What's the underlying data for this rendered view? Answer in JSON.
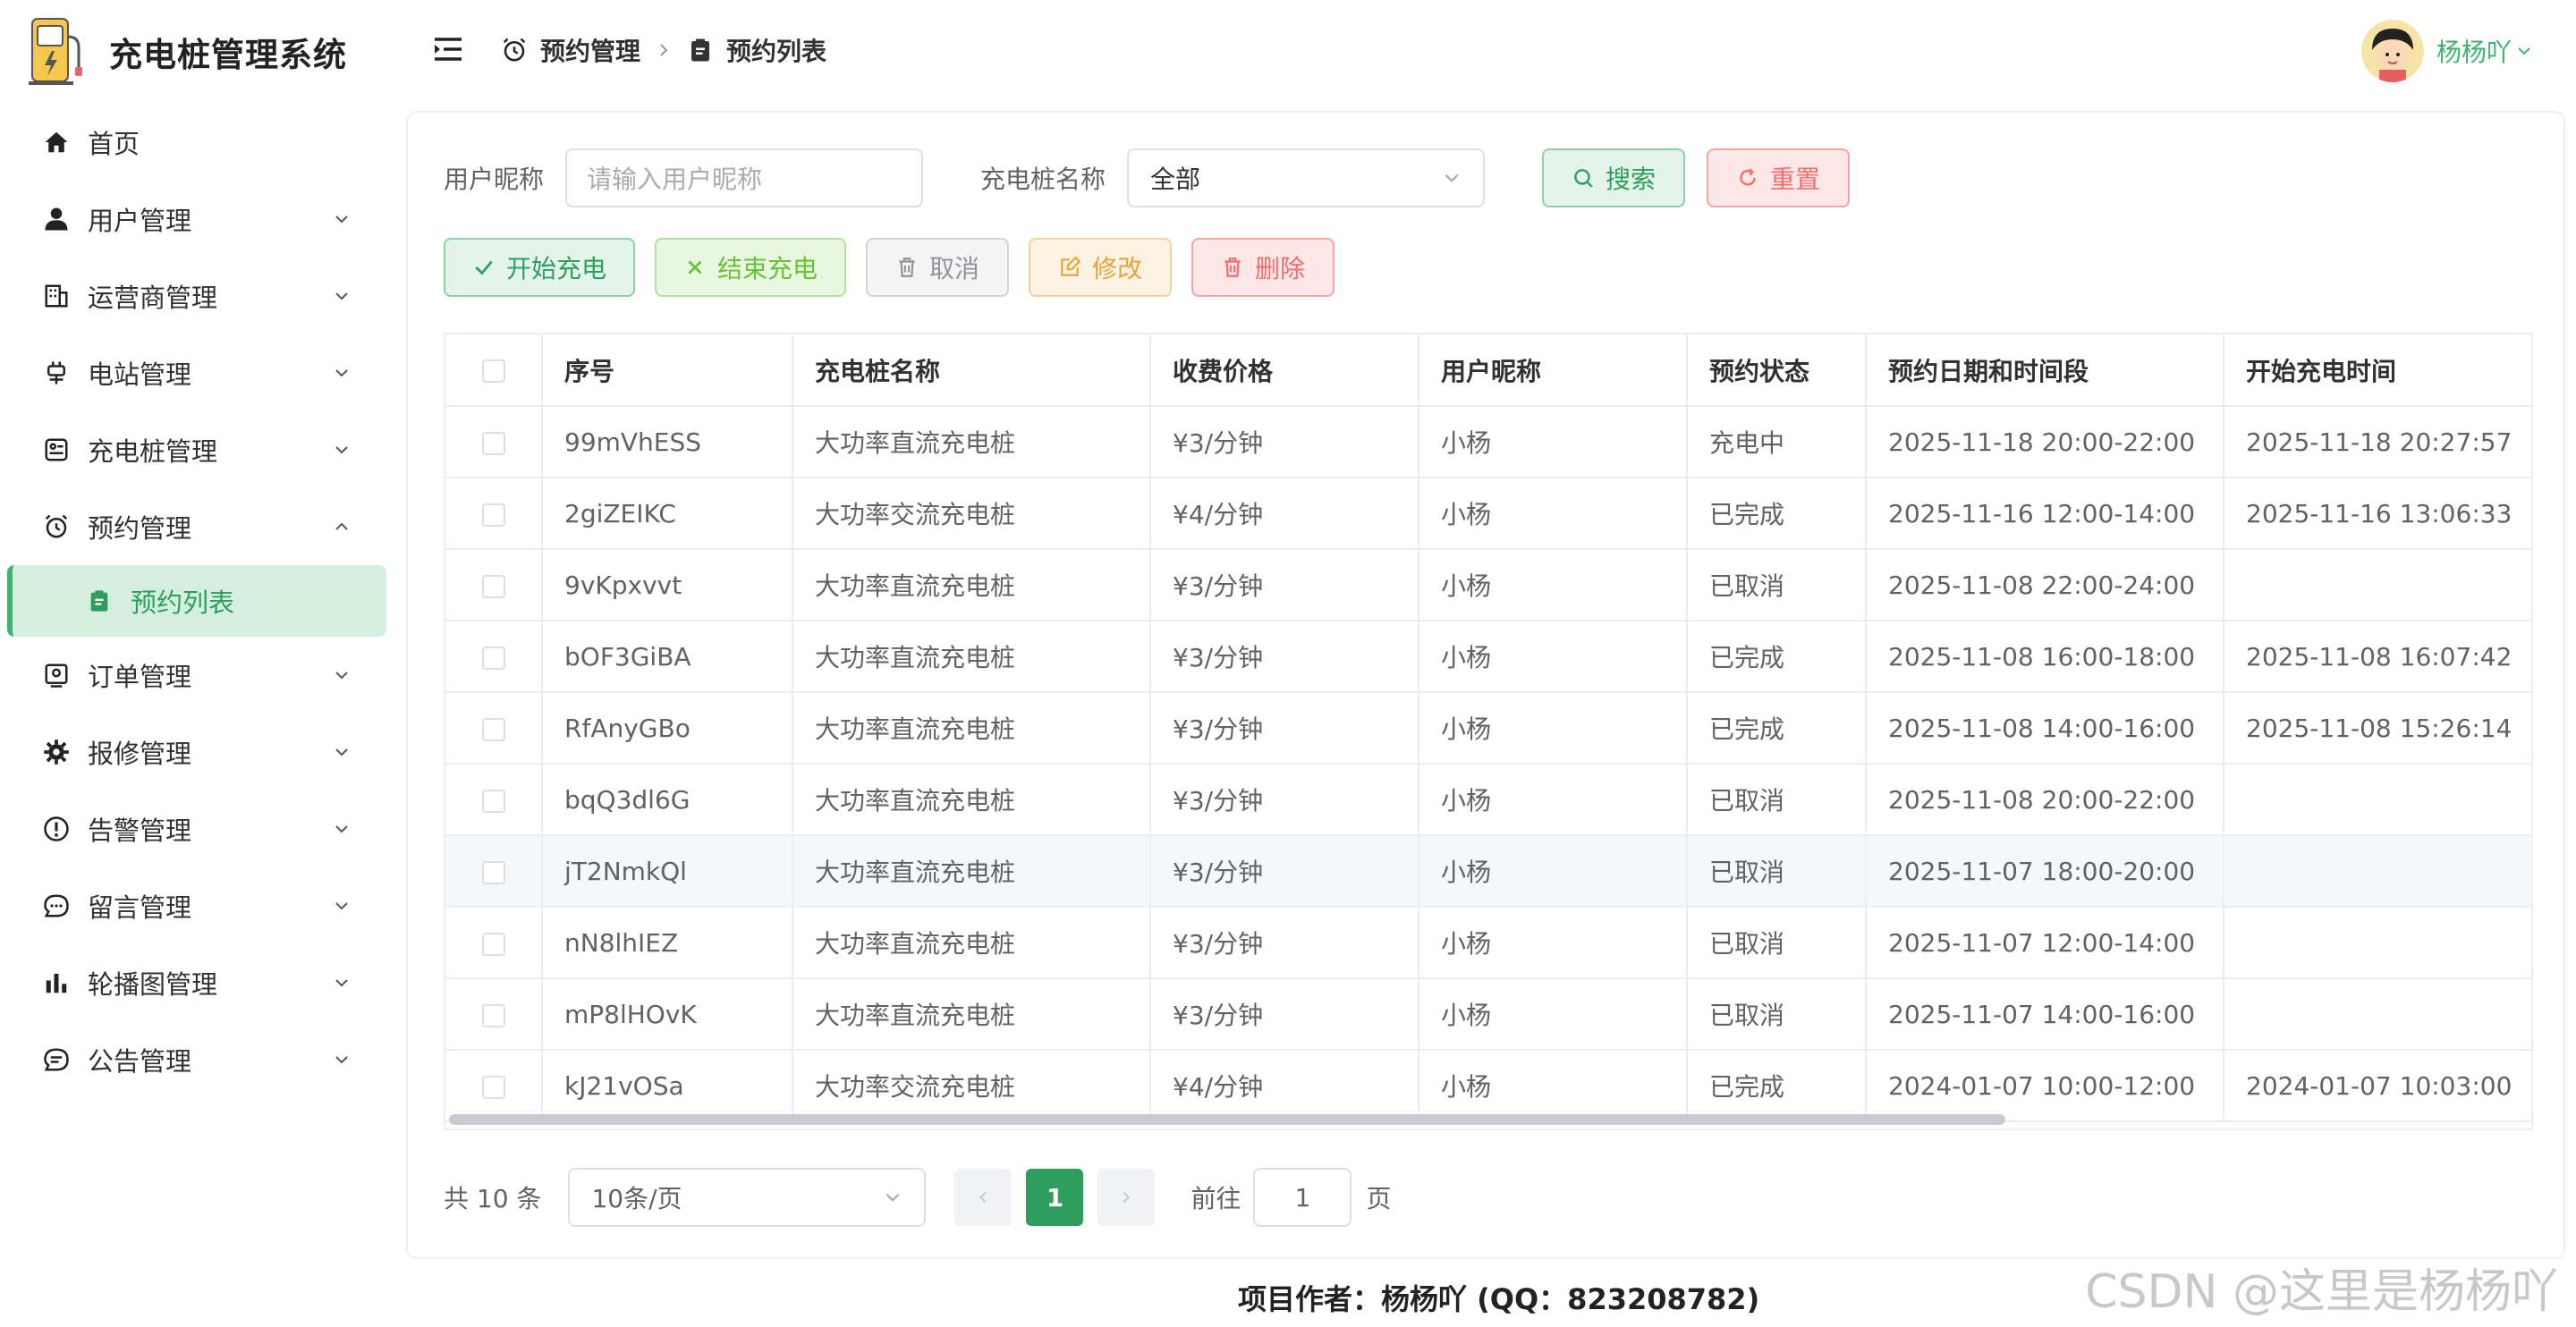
{
  "app": {
    "title": "充电桩管理系统"
  },
  "sidebar": {
    "items": [
      {
        "label": "首页",
        "icon": "home-icon",
        "has_chevron": false
      },
      {
        "label": "用户管理",
        "icon": "user-icon",
        "has_chevron": true
      },
      {
        "label": "运营商管理",
        "icon": "building-icon",
        "has_chevron": true
      },
      {
        "label": "电站管理",
        "icon": "plug-icon",
        "has_chevron": true
      },
      {
        "label": "充电桩管理",
        "icon": "charger-icon",
        "has_chevron": true
      },
      {
        "label": "预约管理",
        "icon": "alarm-clock-icon",
        "has_chevron": true,
        "expanded": true
      },
      {
        "label": "预约列表",
        "icon": "clipboard-icon",
        "sub": true,
        "active": true
      },
      {
        "label": "订单管理",
        "icon": "order-icon",
        "has_chevron": true
      },
      {
        "label": "报修管理",
        "icon": "gear-icon",
        "has_chevron": true
      },
      {
        "label": "告警管理",
        "icon": "warning-icon",
        "has_chevron": true
      },
      {
        "label": "留言管理",
        "icon": "chat-icon",
        "has_chevron": true
      },
      {
        "label": "轮播图管理",
        "icon": "bar-chart-icon",
        "has_chevron": true
      },
      {
        "label": "公告管理",
        "icon": "notice-icon",
        "has_chevron": true
      }
    ]
  },
  "header": {
    "breadcrumb": [
      "预约管理",
      "预约列表"
    ],
    "user_name": "杨杨吖"
  },
  "filters": {
    "nickname_label": "用户昵称",
    "nickname_placeholder": "请输入用户昵称",
    "charger_label": "充电桩名称",
    "charger_value": "全部",
    "search_label": "搜索",
    "reset_label": "重置"
  },
  "actions": {
    "start": "开始充电",
    "end": "结束充电",
    "cancel": "取消",
    "edit": "修改",
    "delete": "删除"
  },
  "table": {
    "columns": [
      "序号",
      "充电桩名称",
      "收费价格",
      "用户昵称",
      "预约状态",
      "预约日期和时间段",
      "开始充电时间"
    ],
    "rows": [
      [
        "99mVhESS",
        "大功率直流充电桩",
        "¥3/分钟",
        "小杨",
        "充电中",
        "2025-11-18 20:00-22:00",
        "2025-11-18 20:27:57"
      ],
      [
        "2giZEIKC",
        "大功率交流充电桩",
        "¥4/分钟",
        "小杨",
        "已完成",
        "2025-11-16 12:00-14:00",
        "2025-11-16 13:06:33"
      ],
      [
        "9vKpxvvt",
        "大功率直流充电桩",
        "¥3/分钟",
        "小杨",
        "已取消",
        "2025-11-08 22:00-24:00",
        ""
      ],
      [
        "bOF3GiBA",
        "大功率直流充电桩",
        "¥3/分钟",
        "小杨",
        "已完成",
        "2025-11-08 16:00-18:00",
        "2025-11-08 16:07:42"
      ],
      [
        "RfAnyGBo",
        "大功率直流充电桩",
        "¥3/分钟",
        "小杨",
        "已完成",
        "2025-11-08 14:00-16:00",
        "2025-11-08 15:26:14"
      ],
      [
        "bqQ3dl6G",
        "大功率直流充电桩",
        "¥3/分钟",
        "小杨",
        "已取消",
        "2025-11-08 20:00-22:00",
        ""
      ],
      [
        "jT2NmkQl",
        "大功率直流充电桩",
        "¥3/分钟",
        "小杨",
        "已取消",
        "2025-11-07 18:00-20:00",
        ""
      ],
      [
        "nN8lhIEZ",
        "大功率直流充电桩",
        "¥3/分钟",
        "小杨",
        "已取消",
        "2025-11-07 12:00-14:00",
        ""
      ],
      [
        "mP8lHOvK",
        "大功率直流充电桩",
        "¥3/分钟",
        "小杨",
        "已取消",
        "2025-11-07 14:00-16:00",
        ""
      ],
      [
        "kJ21vOSa",
        "大功率交流充电桩",
        "¥4/分钟",
        "小杨",
        "已完成",
        "2024-01-07 10:00-12:00",
        "2024-01-07 10:03:00"
      ]
    ],
    "hover_row_index": 6
  },
  "pagination": {
    "total": "共 10 条",
    "page_size": "10条/页",
    "current_page": "1",
    "goto_label": "前往",
    "goto_value": "1",
    "page_suffix": "页"
  },
  "footer": {
    "author": "项目作者：杨杨吖 (QQ：823208782)"
  },
  "watermark": "CSDN @这里是杨杨吖",
  "colors": {
    "accent": "#2e9e5c",
    "danger": "#f56c6c",
    "warning": "#e6a23c",
    "success": "#67c23a",
    "info": "#909399"
  }
}
